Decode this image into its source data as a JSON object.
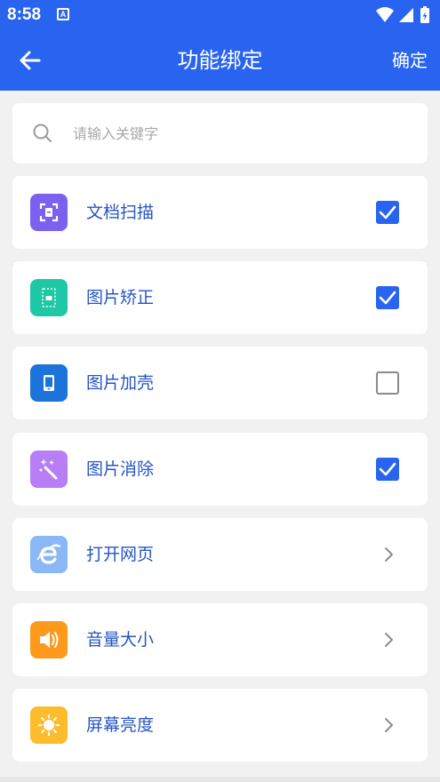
{
  "status_bar": {
    "time": "8:58",
    "notification_icon": "A"
  },
  "header": {
    "title": "功能绑定",
    "confirm_label": "确定"
  },
  "search": {
    "placeholder": "请输入关键字"
  },
  "colors": {
    "primary": "#2864f0",
    "label": "#2555c4",
    "background": "#f1f1f1"
  },
  "items": [
    {
      "label": "文档扫描",
      "icon": "doc-scan-icon",
      "icon_color": "#7b61f0",
      "control": "checkbox",
      "checked": true
    },
    {
      "label": "图片矫正",
      "icon": "image-correct-icon",
      "icon_color": "#1ec8a6",
      "control": "checkbox",
      "checked": true
    },
    {
      "label": "图片加壳",
      "icon": "phone-shell-icon",
      "icon_color": "#1c73da",
      "control": "checkbox",
      "checked": false
    },
    {
      "label": "图片消除",
      "icon": "magic-wand-icon",
      "icon_color": "#b77ef5",
      "control": "checkbox",
      "checked": true
    },
    {
      "label": "打开网页",
      "icon": "browser-e-icon",
      "icon_color": "#8ab7f5",
      "control": "chevron"
    },
    {
      "label": "音量大小",
      "icon": "speaker-icon",
      "icon_color": "#fd9a1c",
      "control": "chevron"
    },
    {
      "label": "屏幕亮度",
      "icon": "brightness-icon",
      "icon_color": "#fcbc2c",
      "control": "chevron"
    }
  ]
}
